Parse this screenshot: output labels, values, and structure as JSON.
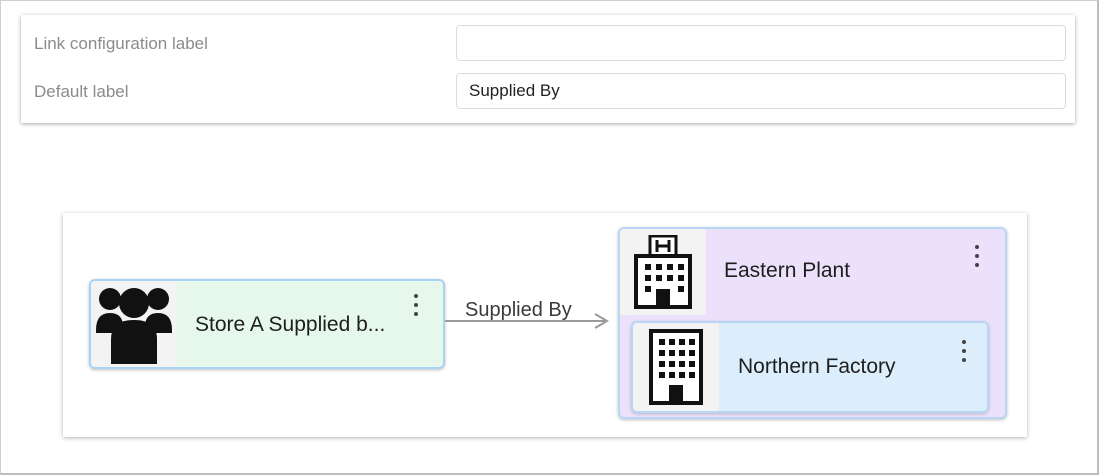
{
  "properties": {
    "link_config": {
      "label": "Link configuration label",
      "value": ""
    },
    "default_label": {
      "label": "Default label",
      "value": "Supplied By"
    }
  },
  "graph": {
    "source_node": {
      "label": "Store A Supplied b...",
      "icon": "people-group-icon",
      "color": "#e6f7ec"
    },
    "edge": {
      "label": "Supplied By"
    },
    "group_node": {
      "label": "Eastern Plant",
      "icon": "hospital-building-icon",
      "color": "#ebe1fb"
    },
    "child_node": {
      "label": "Northern Factory",
      "icon": "office-building-icon",
      "color": "#dcedfb"
    }
  }
}
